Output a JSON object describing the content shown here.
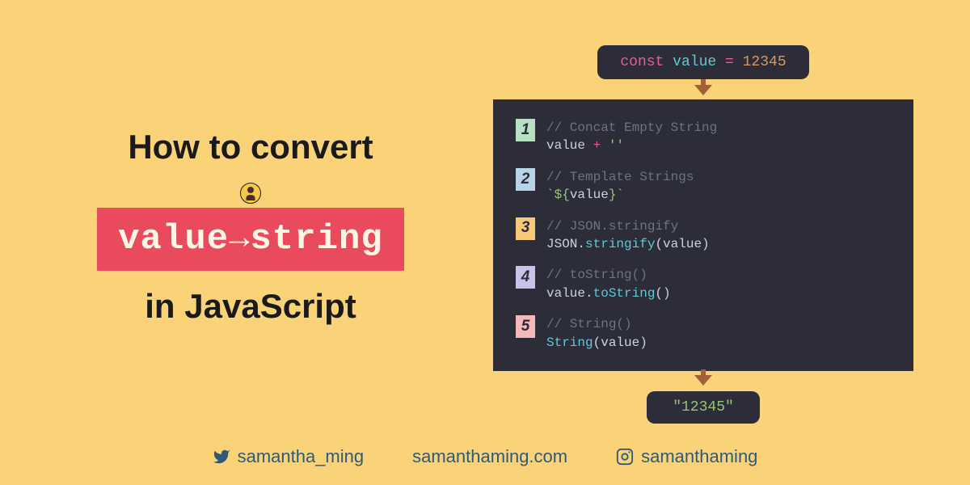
{
  "title": {
    "line1": "How to convert",
    "from": "value",
    "to": "string",
    "line3": "in JavaScript"
  },
  "code_decl": {
    "keyword": "const",
    "var": "value",
    "op": "=",
    "val": "12345"
  },
  "methods": [
    {
      "num": "1",
      "badge": "badge-1",
      "comment": "// Concat Empty String",
      "code_html": "value <span class='k-op'>+</span> <span class='k-str'>''</span>"
    },
    {
      "num": "2",
      "badge": "badge-2",
      "comment": "// Template Strings",
      "code_html": "<span class='k-str'>`${</span>value<span class='k-str'>}`</span>"
    },
    {
      "num": "3",
      "badge": "badge-3",
      "comment": "// JSON.stringify",
      "code_html": "JSON.<span class='k-fn'>stringify</span>(value)"
    },
    {
      "num": "4",
      "badge": "badge-4",
      "comment": "// toString()",
      "code_html": "value.<span class='k-fn'>toString</span>()"
    },
    {
      "num": "5",
      "badge": "badge-5",
      "comment": "// String()",
      "code_html": "<span class='k-fn'>String</span>(value)"
    }
  ],
  "output": "\"12345\"",
  "socials": {
    "twitter": "samantha_ming",
    "website": "samanthaming.com",
    "instagram": "samanthaming"
  }
}
